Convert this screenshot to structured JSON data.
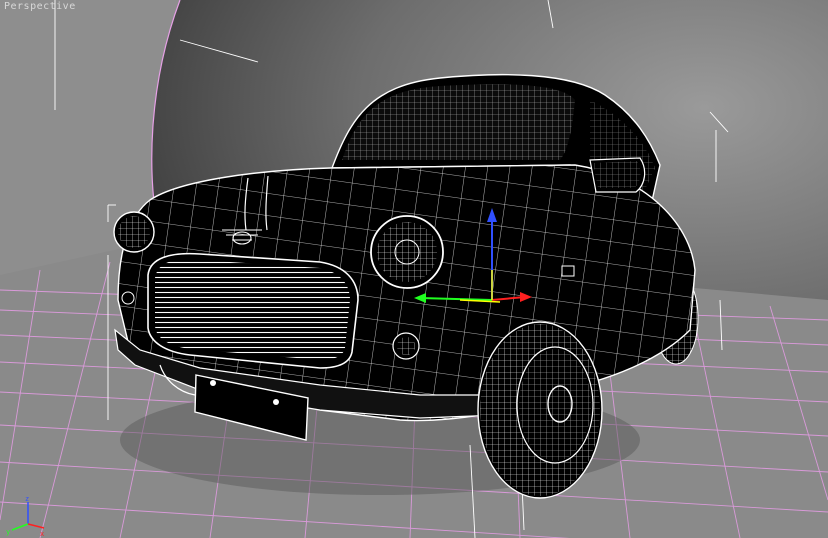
{
  "viewport": {
    "label": "Perspective",
    "colors": {
      "grid": "#e6a0e6",
      "wire": "#ffffff",
      "backdrop_left": "#8c8c8c",
      "gizmo_x": "#ff2020",
      "gizmo_y": "#20ff20",
      "gizmo_z": "#3050ff",
      "gizmo_sel": "#ffff00"
    },
    "gizmo_icons": [
      "transform-gizmo-icon",
      "axis-tripod-icon"
    ]
  }
}
